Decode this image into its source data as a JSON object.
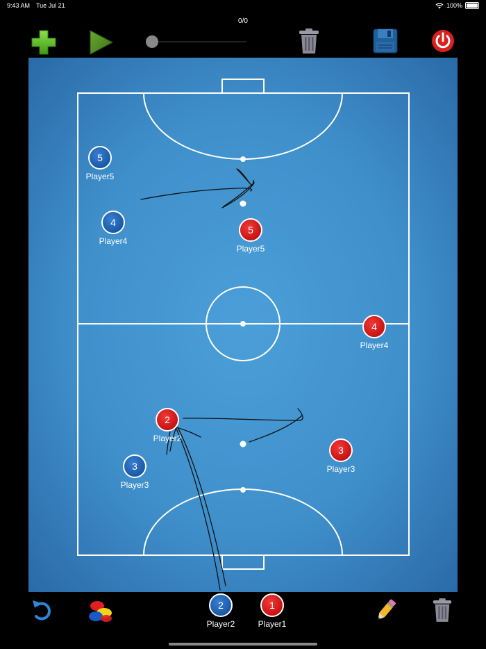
{
  "status": {
    "time": "9:43 AM",
    "date": "Tue Jul 21",
    "battery": "100%"
  },
  "counter": "0/0",
  "toolbar": {
    "add_icon": "plus-icon",
    "play_icon": "play-icon",
    "trash_icon": "trash-icon",
    "save_icon": "floppy-disk-icon",
    "power_icon": "power-icon"
  },
  "slider": {
    "value": 0
  },
  "colors": {
    "field": "#3f8fcb",
    "blue_team": "#0b4a96",
    "red_team": "#c80000",
    "add": "#5bbf24",
    "play": "#4f8f22",
    "power": "#d92020",
    "save": "#1f5f9a"
  },
  "field_tokens": [
    {
      "team": "blue",
      "number": "5",
      "label": "Player5"
    },
    {
      "team": "blue",
      "number": "4",
      "label": "Player4"
    },
    {
      "team": "red",
      "number": "5",
      "label": "Player5"
    },
    {
      "team": "red",
      "number": "4",
      "label": "Player4"
    },
    {
      "team": "red",
      "number": "2",
      "label": "Player2"
    },
    {
      "team": "blue",
      "number": "3",
      "label": "Player3"
    },
    {
      "team": "red",
      "number": "3",
      "label": "Player3"
    }
  ],
  "bench": [
    {
      "team": "blue",
      "number": "2",
      "label": "Player2"
    },
    {
      "team": "red",
      "number": "1",
      "label": "Player1"
    }
  ],
  "bottom_toolbar": {
    "undo_icon": "undo-icon",
    "colors_icon": "color-palette-icon",
    "pencil_icon": "pencil-icon",
    "trash_icon": "trash-icon"
  }
}
